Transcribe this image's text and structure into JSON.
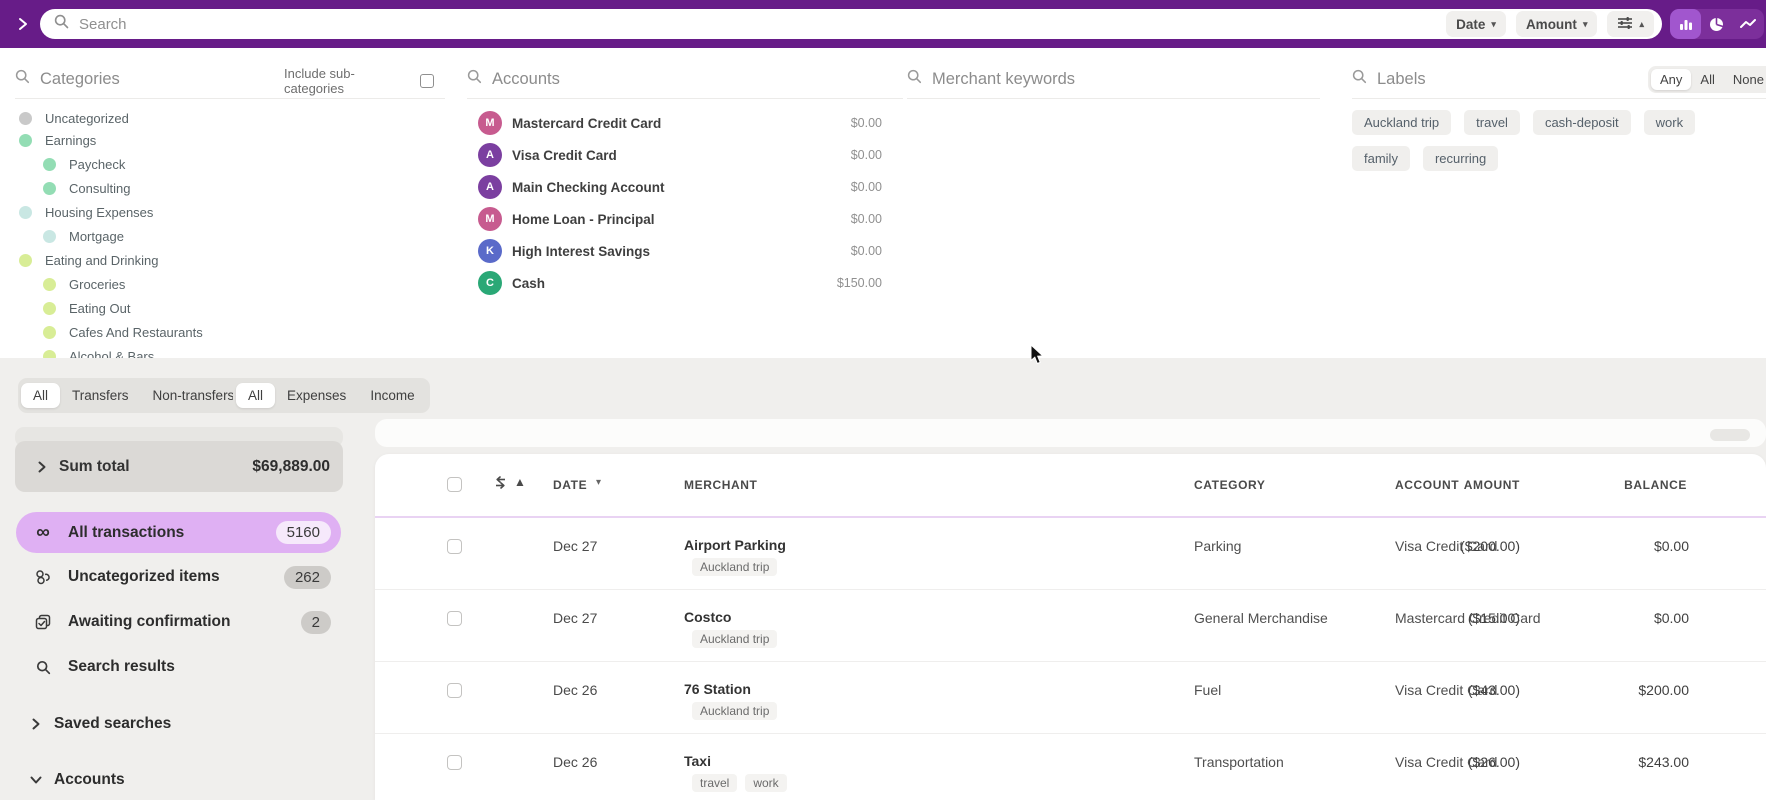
{
  "topbar": {
    "search_placeholder": "Search",
    "date_button": "Date",
    "amount_button": "Amount"
  },
  "filters": {
    "categories": {
      "title": "Categories",
      "include_subcategories_label": "Include sub-categories",
      "items": [
        {
          "label": "Uncategorized",
          "color": "#C9C9C9",
          "level": 0
        },
        {
          "label": "Earnings",
          "color": "#93DDB4",
          "level": 0
        },
        {
          "label": "Paycheck",
          "color": "#93DDB4",
          "level": 1
        },
        {
          "label": "Consulting",
          "color": "#93DDB4",
          "level": 1
        },
        {
          "label": "Housing Expenses",
          "color": "#C9E7E3",
          "level": 0
        },
        {
          "label": "Mortgage",
          "color": "#C9E7E3",
          "level": 1
        },
        {
          "label": "Eating and Drinking",
          "color": "#D8ED96",
          "level": 0
        },
        {
          "label": "Groceries",
          "color": "#D8ED96",
          "level": 1
        },
        {
          "label": "Eating Out",
          "color": "#D8ED96",
          "level": 1
        },
        {
          "label": "Cafes And Restaurants",
          "color": "#D8ED96",
          "level": 1
        },
        {
          "label": "Alcohol & Bars",
          "color": "#D8ED96",
          "level": 1
        }
      ]
    },
    "accounts": {
      "title": "Accounts",
      "items": [
        {
          "initial": "M",
          "color": "#C75B8F",
          "name": "Mastercard Credit Card",
          "balance": "$0.00"
        },
        {
          "initial": "A",
          "color": "#7B3FA0",
          "name": "Visa Credit Card",
          "balance": "$0.00"
        },
        {
          "initial": "A",
          "color": "#7B3FA0",
          "name": "Main Checking Account",
          "balance": "$0.00"
        },
        {
          "initial": "M",
          "color": "#C75B8F",
          "name": "Home Loan - Principal",
          "balance": "$0.00"
        },
        {
          "initial": "K",
          "color": "#5A6AC9",
          "name": "High Interest Savings",
          "balance": "$0.00"
        },
        {
          "initial": "C",
          "color": "#2AA876",
          "name": "Cash",
          "balance": "$150.00"
        }
      ]
    },
    "merchant": {
      "title": "Merchant keywords"
    },
    "labels": {
      "title": "Labels",
      "match_options": [
        "Any",
        "All",
        "None"
      ],
      "selected_match": "Any",
      "chips": [
        "Auckland trip",
        "travel",
        "cash-deposit",
        "work",
        "family",
        "recurring"
      ]
    }
  },
  "filter_tabs": {
    "transfer_group": [
      "All",
      "Transfers",
      "Non-transfers"
    ],
    "transfer_selected": "All",
    "type_group": [
      "All",
      "Expenses",
      "Income"
    ],
    "type_selected": "All"
  },
  "sidebar": {
    "sum_total_label": "Sum total",
    "sum_total_value": "$69,889.00",
    "items": [
      {
        "label": "All transactions",
        "count": "5160"
      },
      {
        "label": "Uncategorized items",
        "count": "262"
      },
      {
        "label": "Awaiting confirmation",
        "count": "2"
      },
      {
        "label": "Search results",
        "count": ""
      }
    ],
    "saved_searches_label": "Saved searches",
    "accounts_label": "Accounts"
  },
  "table": {
    "columns": [
      "DATE",
      "MERCHANT",
      "AMOUNT",
      "CATEGORY",
      "ACCOUNT",
      "BALANCE"
    ],
    "rows": [
      {
        "date": "Dec 27",
        "merchant": "Airport Parking",
        "labels": [
          "Auckland trip"
        ],
        "amount": "($200.00)",
        "category": "Parking",
        "account": "Visa Credit Card",
        "balance": "$0.00"
      },
      {
        "date": "Dec 27",
        "merchant": "Costco",
        "labels": [
          "Auckland trip"
        ],
        "amount": "($15.00)",
        "category": "General Merchandise",
        "account": "Mastercard Credit Card",
        "balance": "$0.00"
      },
      {
        "date": "Dec 26",
        "merchant": "76 Station",
        "labels": [
          "Auckland trip"
        ],
        "amount": "($43.00)",
        "category": "Fuel",
        "account": "Visa Credit Card",
        "balance": "$200.00"
      },
      {
        "date": "Dec 26",
        "merchant": "Taxi",
        "labels": [
          "travel",
          "work"
        ],
        "amount": "($26.00)",
        "category": "Transportation",
        "account": "Visa Credit Card",
        "balance": "$243.00"
      }
    ]
  },
  "colors": {
    "topbar": "#671C88",
    "chart_toggle_bg": "#7C2F9B",
    "chart_toggle_selected": "#A156CE",
    "active_nav_pill": "#DFB0F3",
    "table_header_accent": "#E9D3F3"
  }
}
